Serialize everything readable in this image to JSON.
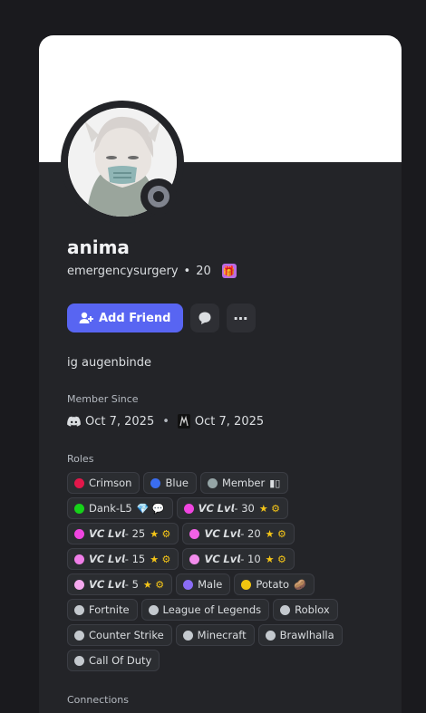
{
  "profile": {
    "display_name": "anima",
    "username": "emergencysurgery",
    "separator": "•",
    "level": "20",
    "bio": "ig augenbinde"
  },
  "actions": {
    "add_friend_label": "Add Friend",
    "more_label": "⋯"
  },
  "member_since": {
    "title": "Member Since",
    "discord_date": "Oct 7, 2025",
    "server_date": "Oct 7, 2025"
  },
  "roles": {
    "title": "Roles",
    "items": [
      {
        "label": "Crimson",
        "color": "#e3174a",
        "emoji": ""
      },
      {
        "label": "Blue",
        "color": "#3a6df0",
        "emoji": ""
      },
      {
        "label": "Member",
        "color": "#95a5a6",
        "emoji": "▮▯"
      },
      {
        "label": "Dank-L5",
        "color": "#16d219",
        "emoji": "💎 💬"
      },
      {
        "label": "𝙑𝘾 𝙇𝙫𝙡- 30",
        "color": "#f045e0",
        "emoji": "★ ⚙"
      },
      {
        "label": "𝙑𝘾 𝙇𝙫𝙡- 25",
        "color": "#f045e0",
        "emoji": "★ ⚙"
      },
      {
        "label": "𝙑𝘾 𝙇𝙫𝙡- 20",
        "color": "#f262e6",
        "emoji": "★ ⚙"
      },
      {
        "label": "𝙑𝘾 𝙇𝙫𝙡- 15",
        "color": "#f07ee8",
        "emoji": "★ ⚙"
      },
      {
        "label": "𝙑𝘾 𝙇𝙫𝙡- 10",
        "color": "#f38cec",
        "emoji": "★ ⚙"
      },
      {
        "label": "𝙑𝘾 𝙇𝙫𝙡- 5",
        "color": "#f6a9ef",
        "emoji": "★ ⚙"
      },
      {
        "label": "Male",
        "color": "#8a6cf5",
        "emoji": ""
      },
      {
        "label": "Potato",
        "color": "#f1c40f",
        "emoji": "🥔"
      },
      {
        "label": "Fortnite",
        "color": "#c4c9ce",
        "emoji": ""
      },
      {
        "label": "League of Legends",
        "color": "#c4c9ce",
        "emoji": ""
      },
      {
        "label": "Roblox",
        "color": "#c4c9ce",
        "emoji": ""
      },
      {
        "label": "Counter Strike",
        "color": "#c4c9ce",
        "emoji": ""
      },
      {
        "label": "Minecraft",
        "color": "#c4c9ce",
        "emoji": ""
      },
      {
        "label": "Brawlhalla",
        "color": "#c4c9ce",
        "emoji": ""
      },
      {
        "label": "Call Of Duty",
        "color": "#c4c9ce",
        "emoji": ""
      }
    ]
  },
  "connections": {
    "title": "Connections"
  },
  "colors": {
    "accent": "#5865f2",
    "card_bg": "#232428",
    "page_bg": "#1a1a1e"
  }
}
